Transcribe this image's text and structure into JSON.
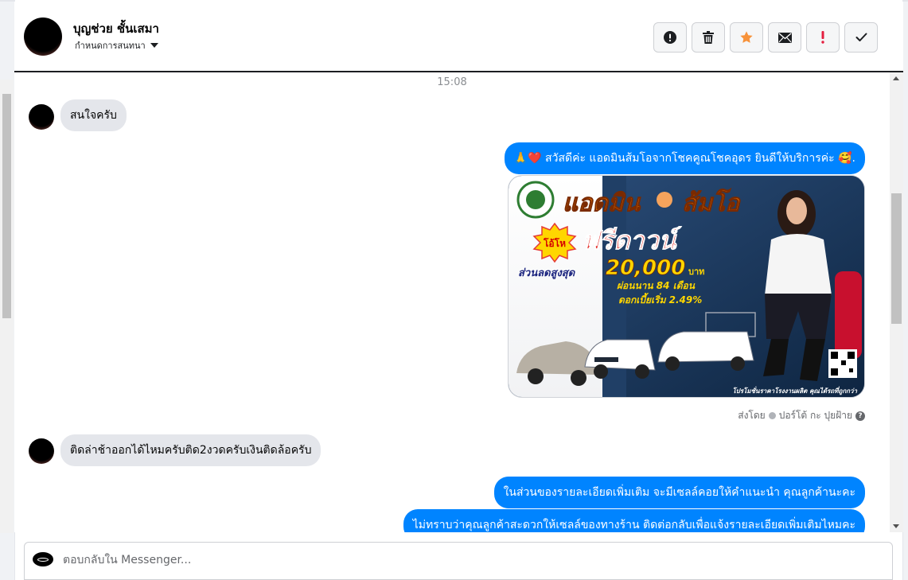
{
  "header": {
    "contact_name": "บุญช่วย ชั้นเสมา",
    "assign_label": "กำหนดการสนทนา",
    "actions": [
      {
        "name": "report-button",
        "icon": "exclamation-circle-icon"
      },
      {
        "name": "delete-button",
        "icon": "trash-icon"
      },
      {
        "name": "star-button",
        "icon": "star-icon"
      },
      {
        "name": "mark-unread-button",
        "icon": "envelope-icon"
      },
      {
        "name": "important-button",
        "icon": "exclamation-mark-icon"
      },
      {
        "name": "done-button",
        "icon": "check-icon"
      }
    ]
  },
  "conversation": {
    "timestamp": "15:08",
    "messages": {
      "m1": "สนใจครับ",
      "m2_prefix": "🙏❤️",
      "m2": "สวัสดีค่ะ แอดมินส้มโอจากโชคคูณโชคอุดร ยินดีให้บริการค่ะ 🥰.",
      "m3": "ติดล่าช้าออกได้ไหมครับติด2งวดครับเงินติดล้อครับ",
      "m4": "ในส่วนของรายละเอียดเพิ่มเติม จะมีเซลล์คอยให้คำแนะนำ คุณลูกค้านะคะ",
      "m5": "ไม่ทราบว่าคุณลูกค้าสะดวกให้เซลล์ของทางร้าน ติดต่อกลับเพื่อแจ้งรายละเอียดเพิ่มเติมไหมคะ"
    },
    "sent_by_prefix": "ส่งโดย",
    "sent_by_name": "ปอร์โต้ กะ ปุยฝ้าย"
  },
  "promo": {
    "title": "แอดมิน",
    "title2": "ส้มโอ",
    "badge": "โอ้โห",
    "headline": "ฟรีดาวน์",
    "discount_label": "ส่วนลดสูงสุด",
    "discount_value": "20,000",
    "discount_unit": "บาท",
    "installment": "ผ่อนนาน 84 เดือน",
    "interest": "ดอกเบี้ยเริ่ม 2.49%",
    "footer": "โปรโมชั่นราคาโรงงานผลิต คุณได้รถที่ถูกกว่า"
  },
  "reply": {
    "placeholder": "ตอบกลับใน Messenger..."
  },
  "colors": {
    "outgoing_bubble": "#0084ff",
    "incoming_bubble": "#e4e6eb",
    "star": "#f7923a",
    "important": "#e41e3f"
  }
}
